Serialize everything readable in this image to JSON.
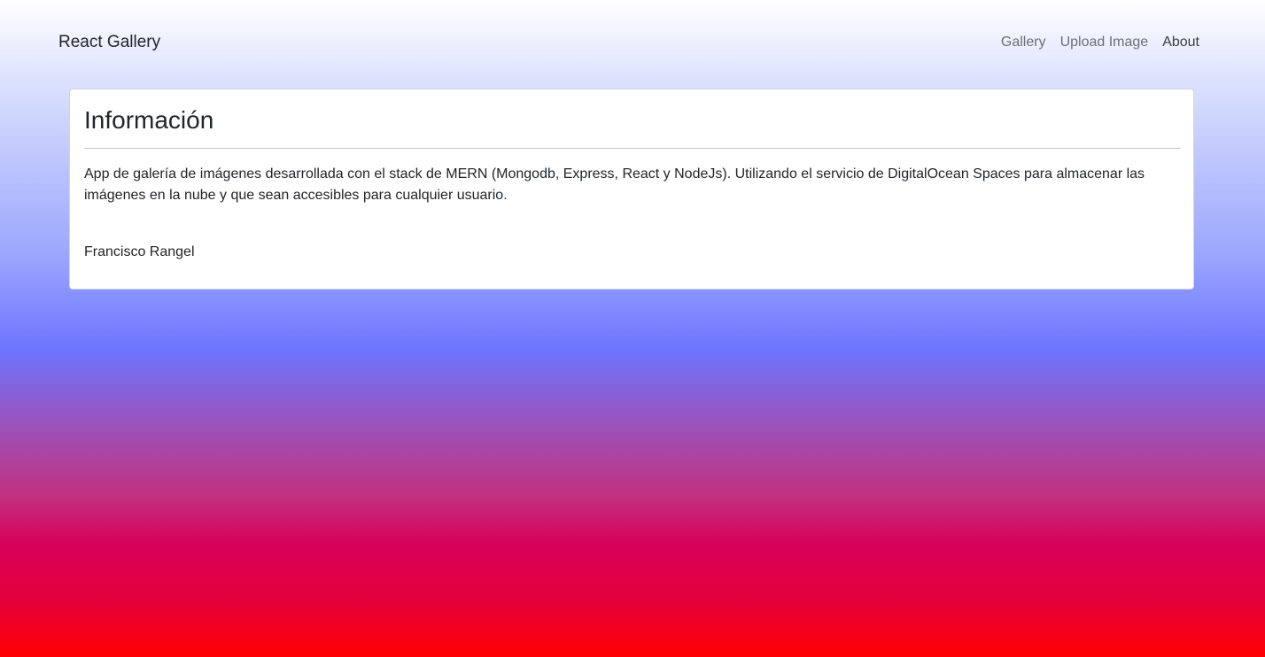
{
  "navbar": {
    "brand": "React Gallery",
    "links": [
      {
        "label": "Gallery",
        "active": false
      },
      {
        "label": "Upload Image",
        "active": false
      },
      {
        "label": "About",
        "active": true
      }
    ]
  },
  "about": {
    "title": "Información",
    "description": "App de galería de imágenes desarrollada con el stack de MERN (Mongodb, Express, React y NodeJs). Utilizando el servicio de DigitalOcean Spaces para almacenar las imágenes en la nube y que sean accesibles para cualquier usuario.",
    "author": "Francisco Rangel"
  },
  "colors": {
    "background_top": "#ffffff",
    "background_middle": "#6d74ff",
    "background_bottom": "#ff0000",
    "card": "#ffffff",
    "text": "#212529"
  }
}
